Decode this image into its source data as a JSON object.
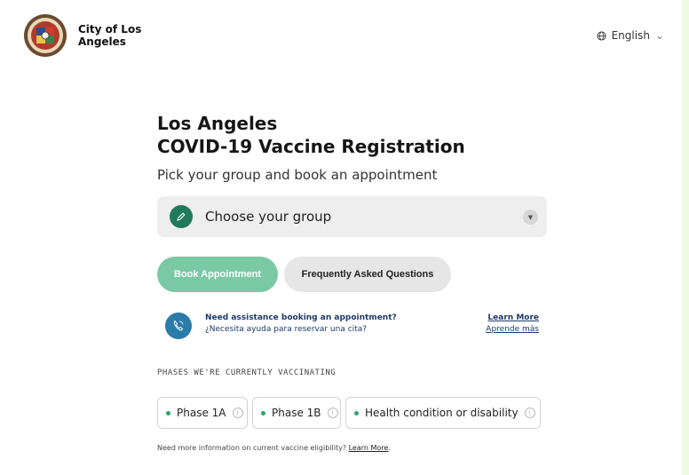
{
  "header": {
    "city_name": "City of Los Angeles",
    "language": "English"
  },
  "main": {
    "title_line1": "Los Angeles",
    "title_line2": "COVID-19 Vaccine Registration",
    "subtitle": "Pick your group and book an appointment",
    "group_select_label": "Choose your group",
    "book_button": "Book Appointment",
    "faq_button": "Frequently Asked Questions"
  },
  "assist": {
    "question_en": "Need assistance booking an appointment?",
    "question_es": "¿Necesita ayuda para reservar una cita?",
    "learn_more_en": "Learn More",
    "learn_more_es": "Aprende más"
  },
  "phases": {
    "heading": "PHASES WE'RE CURRENTLY VACCINATING",
    "items": [
      "Phase 1A",
      "Phase 1B",
      "Health condition or disability"
    ]
  },
  "footer_note": {
    "text": "Need more information on current vaccine eligibility? ",
    "link": "Learn More",
    "suffix": "."
  },
  "colors": {
    "accent_green": "#1f7a5b",
    "book_button_bg": "#7bc9a4",
    "phone_blue": "#2b7ba8",
    "dot_green": "#2fa36b"
  },
  "icons": [
    "city-seal-icon",
    "globe-icon",
    "chevron-down-icon",
    "pencil-icon",
    "dropdown-arrow-icon",
    "phone-icon",
    "info-icon"
  ]
}
